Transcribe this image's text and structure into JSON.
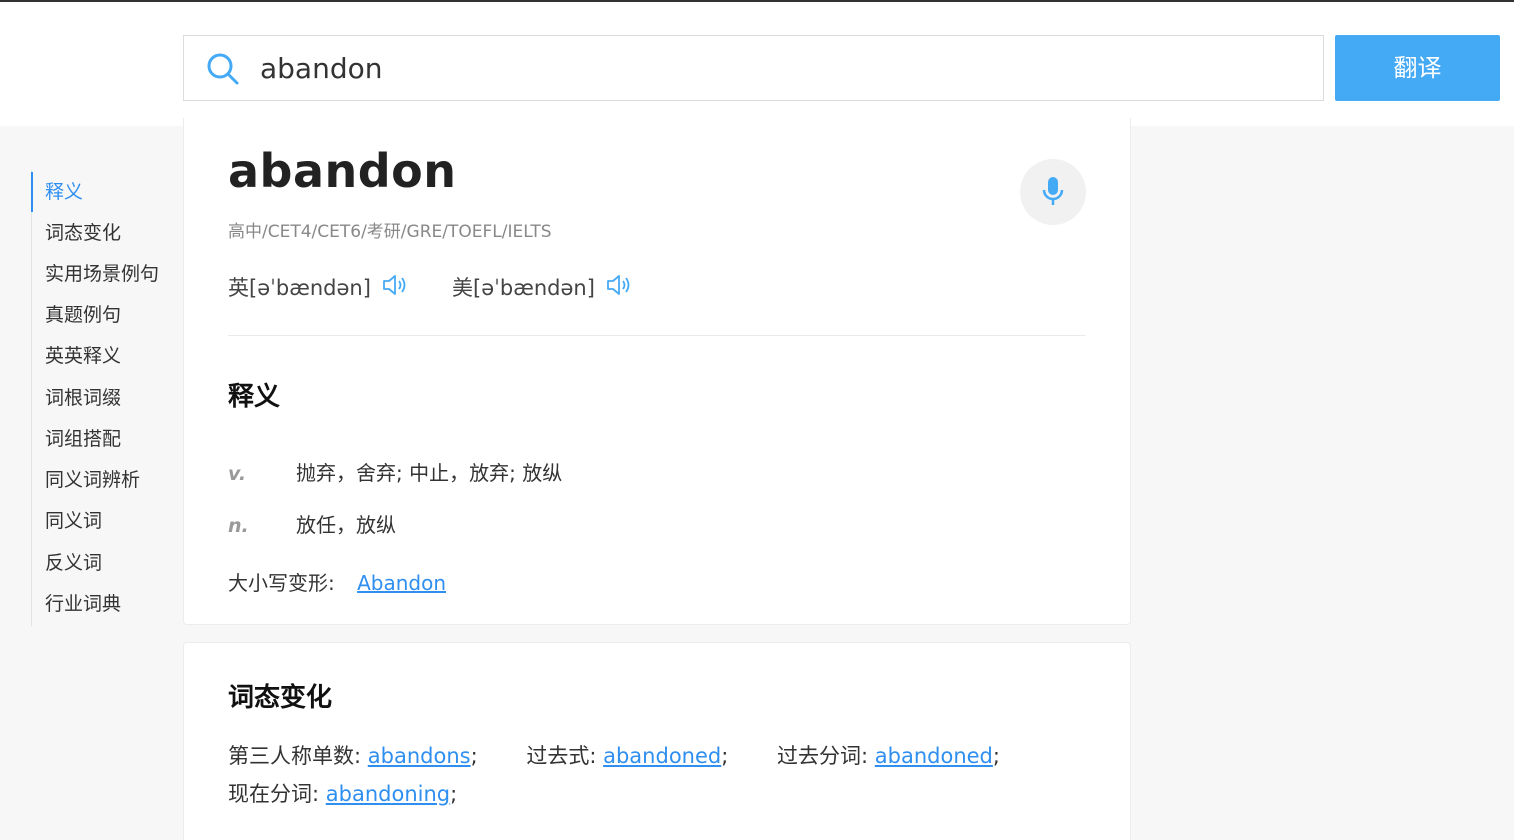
{
  "search": {
    "value": "abandon",
    "button_label": "翻译"
  },
  "sidebar": {
    "items": [
      {
        "label": "释义",
        "active": true
      },
      {
        "label": "词态变化"
      },
      {
        "label": "实用场景例句"
      },
      {
        "label": "真题例句"
      },
      {
        "label": "英英释义"
      },
      {
        "label": "词根词缀"
      },
      {
        "label": "词组搭配"
      },
      {
        "label": "同义词辨析"
      },
      {
        "label": "同义词"
      },
      {
        "label": "反义词"
      },
      {
        "label": "行业词典"
      }
    ]
  },
  "word": {
    "headword": "abandon",
    "tags": "高中/CET4/CET6/考研/GRE/TOEFL/IELTS",
    "phonetic_uk": "英[əˈbændən]",
    "phonetic_us": "美[əˈbændən]"
  },
  "definitions": {
    "title": "释义",
    "entries": [
      {
        "pos": "v.",
        "meaning": "抛弃，舍弃; 中止，放弃; 放纵"
      },
      {
        "pos": "n.",
        "meaning": "放任，放纵"
      }
    ],
    "case_variant_label": "大小写变形:",
    "case_variant_link": "Abandon"
  },
  "inflections": {
    "title": "词态变化",
    "items": [
      {
        "label": "第三人称单数:",
        "value": "abandons"
      },
      {
        "label": "过去式:",
        "value": "abandoned"
      },
      {
        "label": "过去分词:",
        "value": "abandoned"
      },
      {
        "label": "现在分词:",
        "value": "abandoning"
      }
    ]
  },
  "colors": {
    "accent": "#2e8ff1",
    "button": "#45aaf6",
    "background": "#f7f7f7"
  },
  "icons": {
    "search": "search-icon",
    "microphone": "microphone-icon",
    "speaker": "speaker-icon"
  }
}
